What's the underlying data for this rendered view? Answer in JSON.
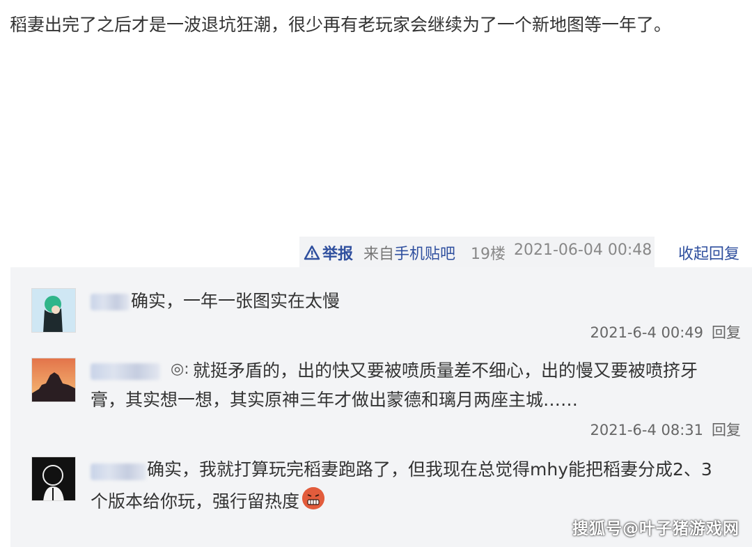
{
  "post": {
    "text": "稻妻出完了之后才是一波退坑狂潮，很少再有老玩家会继续为了一个新地图等一年了。"
  },
  "meta": {
    "report_label": "举报",
    "from_prefix": "来自",
    "client": "手机贴吧",
    "floor": "19楼",
    "time": "2021-06-04 00:48",
    "collapse_label": "收起回复"
  },
  "replies": [
    {
      "text": "确实，一年一张图实在太慢",
      "time": "2021-6-4 00:49",
      "reply_label": "回复"
    },
    {
      "text_line1": "就挺矛盾的，出的快又要被喷质量差不细心，出的慢又要被喷挤牙",
      "text_line2": "膏，其实想一想，其实原神三年才做出蒙德和璃月两座主城……",
      "time": "2021-6-4 08:31",
      "reply_label": "回复"
    },
    {
      "text_line1": "确实，我就打算玩完稻妻跑路了，但我现在总觉得mhy能把稻妻分成2、3",
      "text_line2": "个版本给你玩，强行留热度",
      "emoji": "grimace-emoji"
    }
  ],
  "watermark": "搜狐号@叶子猪游戏网",
  "colors": {
    "link": "#2f4f9e",
    "reply_bg": "#f3f4f6"
  }
}
